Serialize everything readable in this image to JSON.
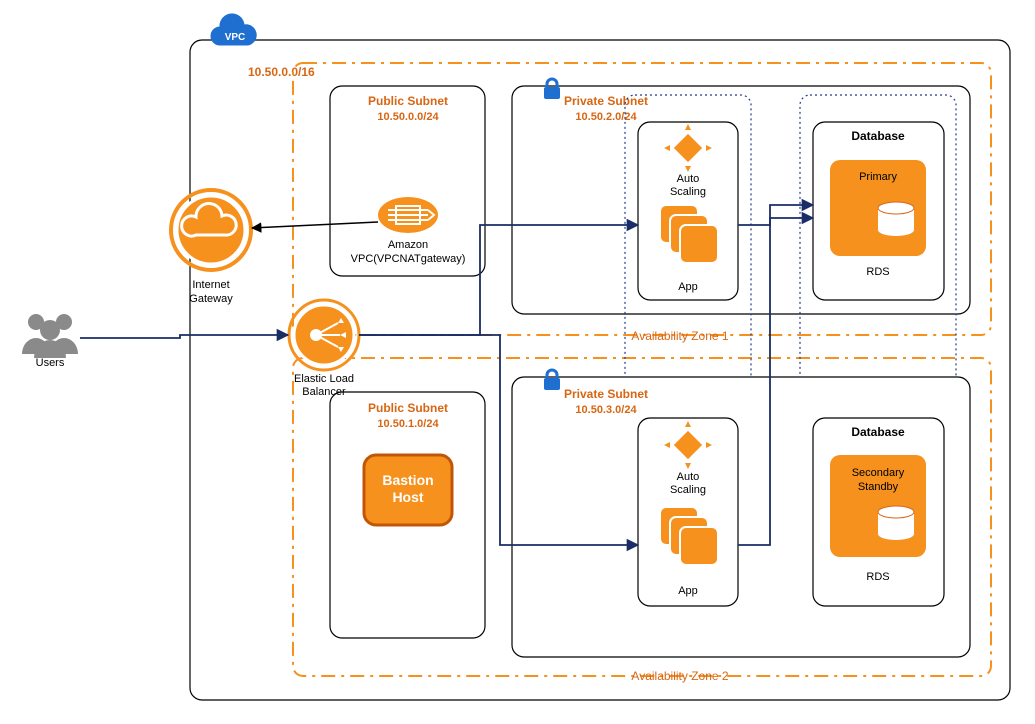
{
  "users_label": "Users",
  "igw_label1": "Internet",
  "igw_label2": "Gateway",
  "vpc_badge": "VPC",
  "vpc_cidr": "10.50.0.0/16",
  "elb_label1": "Elastic Load",
  "elb_label2": "Balancer",
  "nat_label1": "Amazon",
  "nat_label2": "VPC(VPCNATgateway)",
  "az1_label": "Availability Zone 1",
  "az2_label": "Availability Zone 2",
  "public1_title": "Public Subnet",
  "public1_cidr": "10.50.0.0/24",
  "public2_title": "Public Subnet",
  "public2_cidr": "10.50.1.0/24",
  "private1_title": "Private Subnet",
  "private1_cidr": "10.50.2.0/24",
  "private2_title": "Private Subnet",
  "private2_cidr": "10.50.3.0/24",
  "bastion_label1": "Bastion",
  "bastion_label2": "Host",
  "autoscaling_label1": "Auto",
  "autoscaling_label2": "Scaling",
  "app_label": "App",
  "db_title": "Database",
  "rds_label": "RDS",
  "primary_label": "Primary",
  "secondary_label1": "Secondary",
  "secondary_label2": "Standby"
}
